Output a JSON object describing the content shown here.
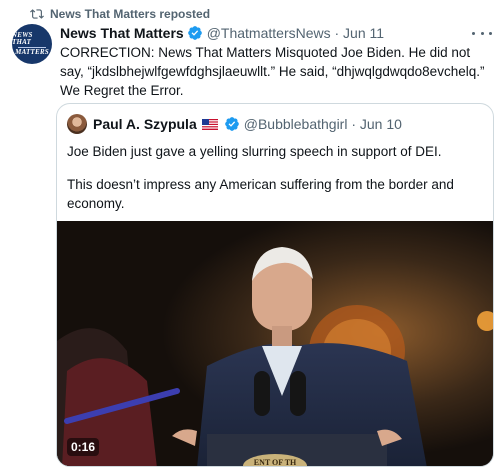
{
  "repost": {
    "label": "News That Matters reposted",
    "icon": "repost-icon"
  },
  "post": {
    "avatar_text": [
      "NEWS THAT",
      "MATTERS"
    ],
    "display_name": "News That Matters",
    "verified": true,
    "meta": "@ThatmattersNews · Jun 11",
    "text": "CORRECTION: News That Matters Misquoted Joe Biden. He did not say, “jkdslbhejwlfgewfdghsjlaeuwllt.” He said, “dhjwqlgdwqdo8evchelq.” We Regret the Error."
  },
  "quote": {
    "display_name": "Paul A. Szypula",
    "flag": "us-flag",
    "verified": true,
    "meta": "@Bubblebathgirl · Jun 10",
    "paragraphs": [
      "Joe Biden just gave a yelling slurring speech in support of DEI.",
      "This doesn’t impress any American suffering from the border and economy."
    ],
    "video": {
      "duration": "0:16",
      "podium_text": "ENT OF TH"
    }
  },
  "colors": {
    "verified": "#1d9bf0",
    "muted_text": "#536471",
    "border": "#cfd9de"
  }
}
